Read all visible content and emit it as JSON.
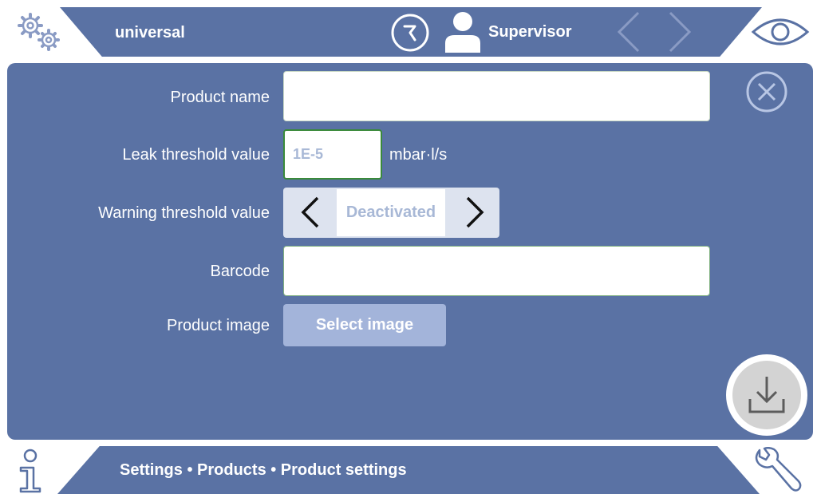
{
  "header": {
    "title": "universal",
    "user_name": "Supervisor",
    "icons": {
      "settings": "gears-icon",
      "clock": "clock-icon",
      "user": "user-icon",
      "back": "chevron-left-icon",
      "forward": "chevron-right-icon",
      "view": "eye-icon"
    }
  },
  "form": {
    "product_name": {
      "label": "Product name",
      "value": ""
    },
    "leak_threshold": {
      "label": "Leak threshold value",
      "value": "1E-5",
      "unit": "mbar·l/s"
    },
    "warning_threshold": {
      "label": "Warning threshold value",
      "value": "Deactivated"
    },
    "barcode": {
      "label": "Barcode",
      "value": ""
    },
    "product_image": {
      "label": "Product image",
      "button_label": "Select image"
    }
  },
  "actions": {
    "close_icon": "close-circle-icon",
    "save_icon": "download-icon"
  },
  "footer": {
    "breadcrumb": "Settings • Products • Product settings",
    "icons": {
      "info": "info-icon",
      "service": "wrench-icon"
    }
  },
  "colors": {
    "primary": "#5a72a4",
    "button": "#a3b4da",
    "placeholder_text": "#a8b8d6",
    "valid_border": "#3a8a3a"
  }
}
